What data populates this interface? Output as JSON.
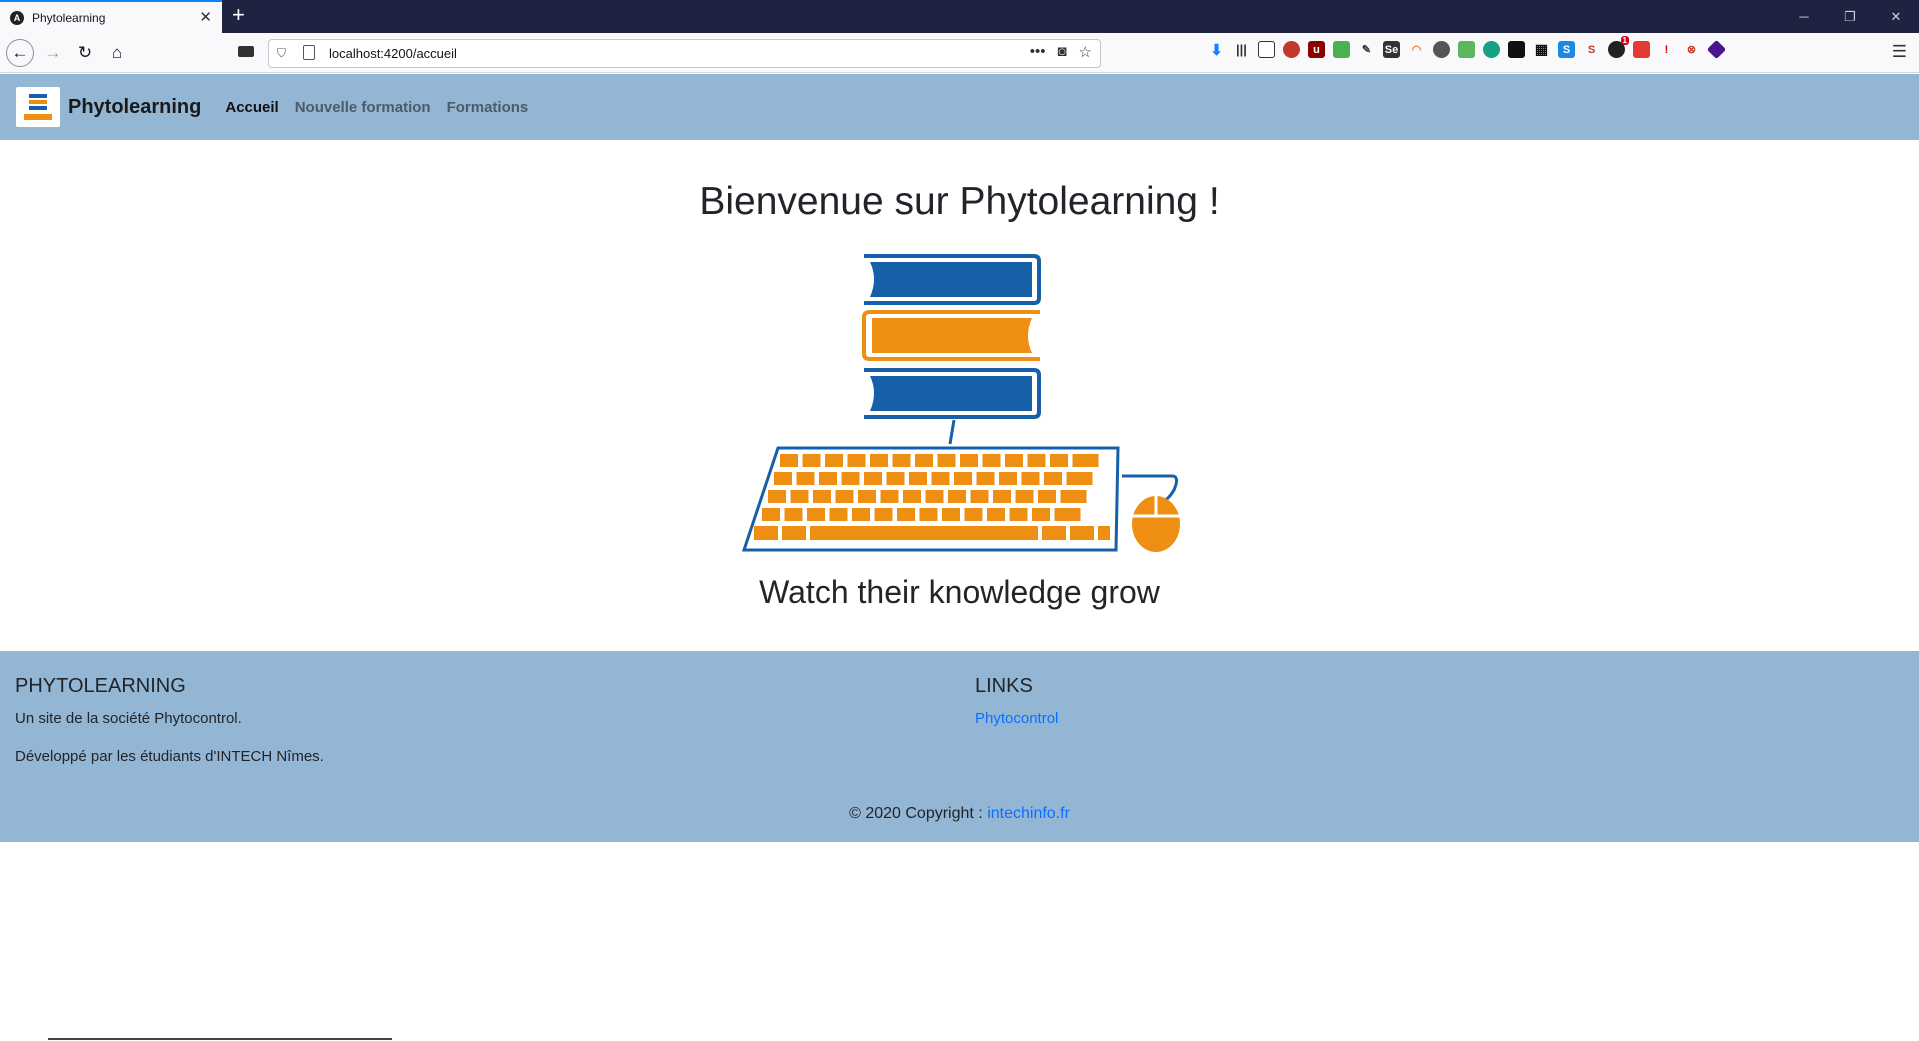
{
  "browser": {
    "tab_title": "Phytolearning",
    "tab_favicon_letter": "A",
    "url": "localhost:4200/accueil",
    "extension_badge": "1"
  },
  "app": {
    "brand": "Phytolearning",
    "nav": [
      {
        "label": "Accueil",
        "active": true
      },
      {
        "label": "Nouvelle formation",
        "active": false
      },
      {
        "label": "Formations",
        "active": false
      }
    ]
  },
  "main": {
    "welcome": "Bienvenue sur Phytolearning !",
    "tagline": "Watch their knowledge grow"
  },
  "footer": {
    "col1_title": "PHYTOLEARNING",
    "col1_line1": "Un site de la société Phytocontrol.",
    "col1_line2": "Développé par les étudiants d'INTECH Nîmes.",
    "col2_title": "LINKS",
    "col2_link": "Phytocontrol",
    "copyright_prefix": "© 2020 Copyright : ",
    "copyright_link": "intechinfo.fr"
  },
  "colors": {
    "nav_bg": "#93b6d5",
    "book_blue": "#1560a8",
    "book_orange": "#ee8f14",
    "link": "#0d6efd"
  }
}
